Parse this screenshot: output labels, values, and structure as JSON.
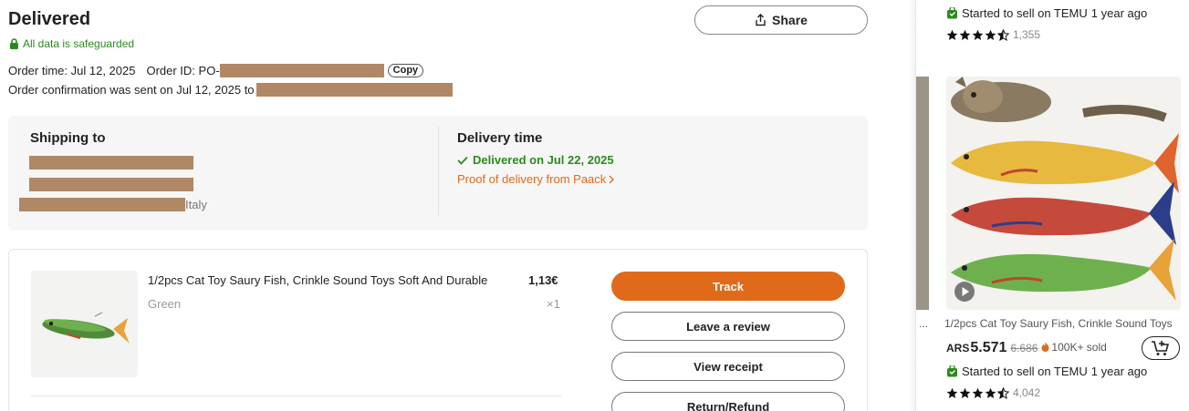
{
  "header": {
    "status_title": "Delivered",
    "safeguard_text": "All data is safeguarded",
    "share_label": "Share"
  },
  "order": {
    "time_label": "Order time: Jul 12, 2025",
    "id_label": "Order ID: PO-",
    "copy_label": "Copy",
    "confirmation_text": "Order confirmation was sent on Jul 12, 2025 to"
  },
  "shipping": {
    "heading": "Shipping to",
    "address_country": "Italy"
  },
  "delivery": {
    "heading": "Delivery time",
    "status": "Delivered on Jul 22, 2025",
    "proof_link": "Proof of delivery from Paack"
  },
  "item": {
    "name": "1/2pcs Cat Toy Saury Fish, Crinkle Sound Toys Soft And Durable",
    "price": "1,13€",
    "variant": "Green",
    "quantity": "×1"
  },
  "actions": {
    "track": "Track",
    "review": "Leave a review",
    "receipt": "View receipt",
    "refund": "Return/Refund"
  },
  "recommendations": {
    "top_badge": {
      "prefix": "Started to sell on TEMU",
      "suffix": "1 year ago"
    },
    "top_rating_count": "1,355",
    "product": {
      "name": "1/2pcs Cat Toy Saury Fish, Crinkle Sound Toys",
      "currency": "ARS",
      "price": "5.571",
      "old_price": "6.686",
      "sold": "100K+ sold",
      "badge": {
        "prefix": "Started to sell on TEMU",
        "suffix": "1 year ago"
      },
      "rating_count": "4,042"
    },
    "truncation": "..."
  },
  "colors": {
    "accent_orange": "#e06a1a",
    "success_green": "#2b8a1e",
    "redaction": "#b08866"
  },
  "icons": [
    "lock-icon",
    "share-icon",
    "check-icon",
    "chevron-right-icon",
    "bag-icon",
    "star-icon",
    "play-icon",
    "flame-icon",
    "add-to-cart-icon"
  ]
}
